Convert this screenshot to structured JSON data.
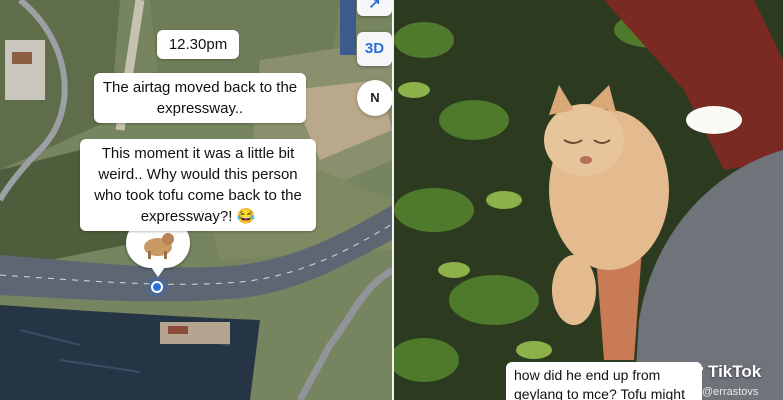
{
  "map": {
    "time_caption": "12.30pm",
    "caption_1": "The airtag moved back to the expressway..",
    "caption_2": "This moment it was a little bit weird.. Why would this person who took tofu come back to the expressway?! 😂",
    "button_3d": "3D",
    "button_directions": "↗",
    "compass_label": "N",
    "pin_avatar": "dog-photo"
  },
  "video": {
    "caption": "how did he end up from geylang to mce? Tofu might",
    "app_name": "TikTok",
    "handle": "@errastovs"
  },
  "colors": {
    "accent_blue": "#2b6fd8",
    "road": "#5e6673",
    "water": "#263545"
  }
}
